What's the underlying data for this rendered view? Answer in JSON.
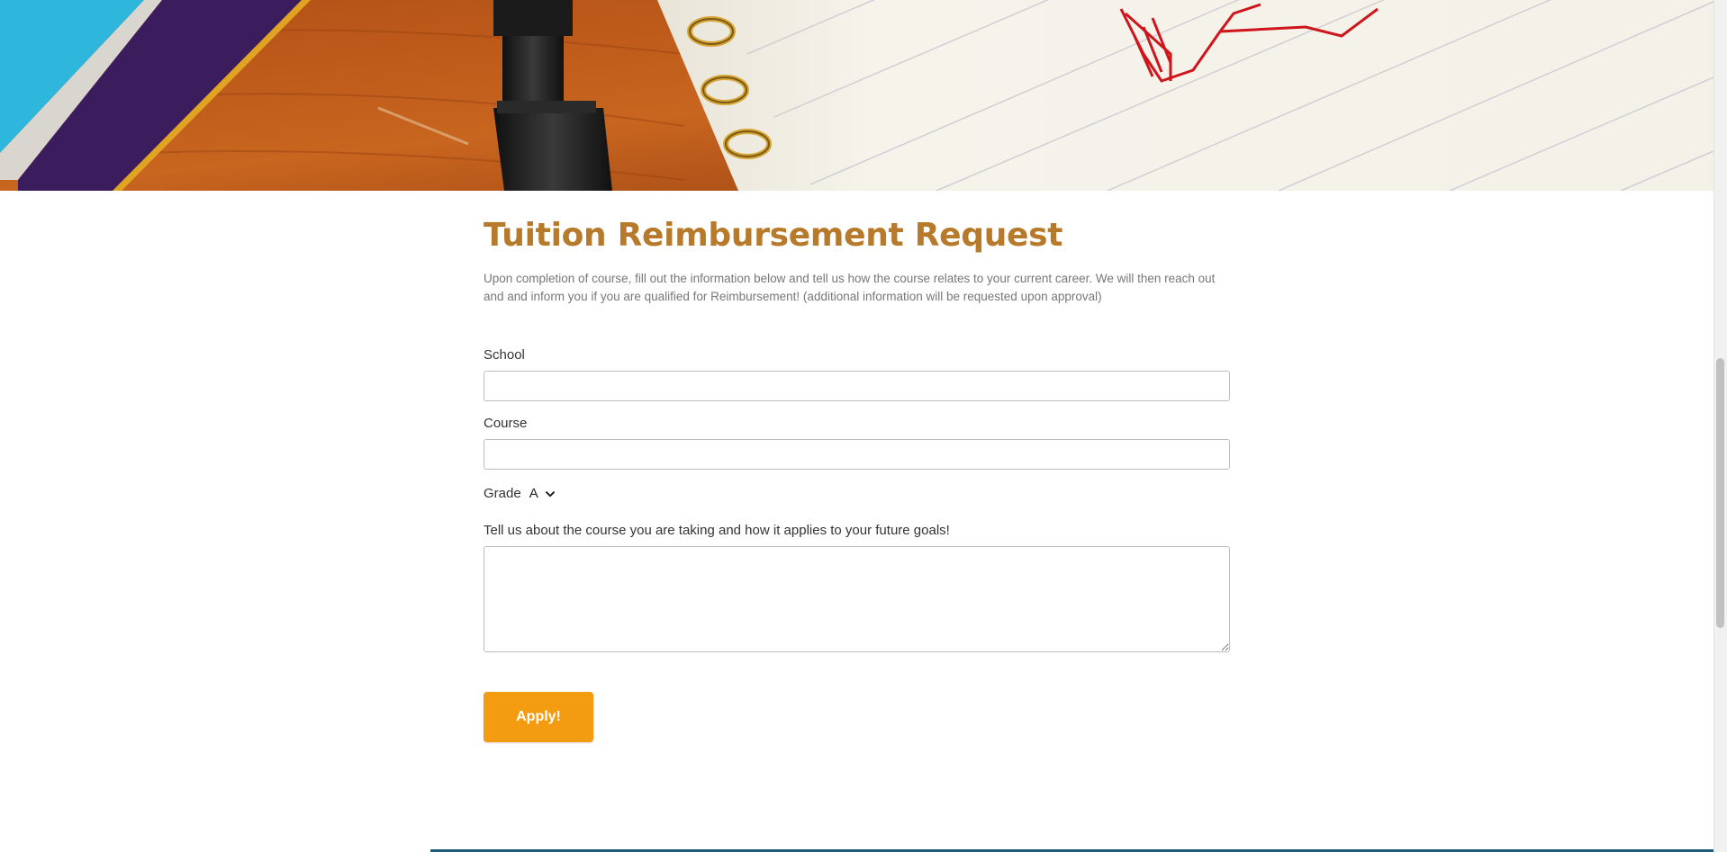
{
  "header": {
    "image_name": "notebook-pen-desk-banner"
  },
  "form": {
    "title": "Tuition Reimbursement Request",
    "intro": "Upon completion of course, fill out the information below and tell us how the course relates to your current career. We will then reach out and and inform you if you are qualified for Reimbursement! (additional information will be requested upon approval)",
    "school": {
      "label": "School",
      "value": ""
    },
    "course": {
      "label": "Course",
      "value": ""
    },
    "grade": {
      "label": "Grade",
      "selected": "A"
    },
    "goals": {
      "label": "Tell us about the course you are taking and how it applies to your future goals!",
      "value": ""
    },
    "submit_label": "Apply!"
  },
  "colors": {
    "title": "#b7792a",
    "button": "#f39c12",
    "footer_rule": "#1f5c7a"
  }
}
